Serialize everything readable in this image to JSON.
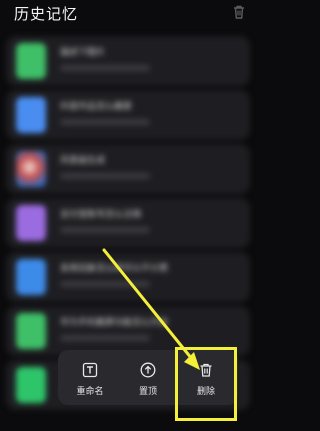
{
  "header": {
    "title": "历史记忆",
    "trash_icon": "trash-icon"
  },
  "list": [
    {
      "title": "描述下图片",
      "thumb_color": "#3fbf68"
    },
    {
      "title": "抖音作品怎么搬家",
      "thumb_color": "#4a8df0"
    },
    {
      "title": "风景画生成",
      "thumb_color": "#6a7fb5"
    },
    {
      "title": "支付宝账号怎么注销",
      "thumb_color": "#9b6be0"
    },
    {
      "title": "发表回复怎么样可以不计费",
      "thumb_color": "#3d8be8"
    },
    {
      "title": "华为手机截屏功能怎么开启",
      "thumb_color": "#3fbf68"
    },
    {
      "title": "",
      "thumb_color": "#2ec46a"
    }
  ],
  "menu": {
    "rename": {
      "label": "重命名",
      "icon": "rename-icon"
    },
    "pin": {
      "label": "置顶",
      "icon": "pin-top-icon"
    },
    "delete": {
      "label": "删除",
      "icon": "trash-icon"
    }
  },
  "colors": {
    "highlight": "#f4ef3b",
    "background": "#0b0b0d"
  }
}
